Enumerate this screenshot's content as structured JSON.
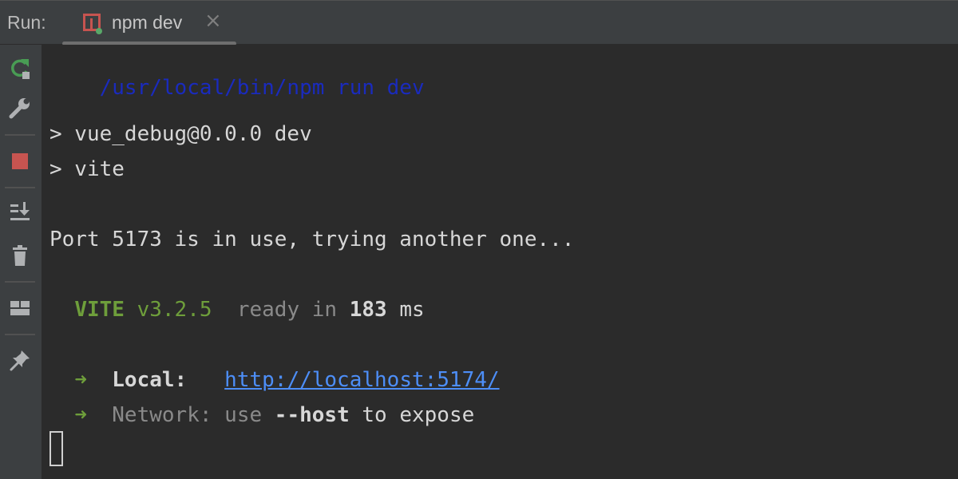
{
  "header": {
    "run_label": "Run:",
    "tab": {
      "title": "npm dev",
      "close": "×",
      "icon": "npm-run-icon"
    }
  },
  "toolbar": {
    "icons": [
      "rerun-icon",
      "wrench-icon",
      "stop-icon",
      "scroll-to-end-icon",
      "trash-icon",
      "layout-icon",
      "pin-icon"
    ]
  },
  "console": {
    "command": "/usr/local/bin/npm run dev",
    "script_line": "> vue_debug@0.0.0 dev",
    "vite_line": "> vite",
    "port_line": "Port 5173 is in use, trying another one...",
    "vite": {
      "name": "VITE",
      "version": "v3.2.5",
      "ready_prefix": "ready in",
      "time": "183",
      "unit": "ms"
    },
    "local": {
      "arrow": "➜",
      "label": "Local:",
      "url": "http://localhost:5174/"
    },
    "network": {
      "arrow": "➜",
      "label": "Network:",
      "use": "use",
      "flag": "--host",
      "suffix": "to expose"
    }
  },
  "colors": {
    "background": "#2b2b2b",
    "panel": "#3c3f41",
    "command": "#1a2bbd",
    "vite_green": "#6e9e3b",
    "link": "#4d8ef7",
    "stop_red": "#c75450"
  }
}
